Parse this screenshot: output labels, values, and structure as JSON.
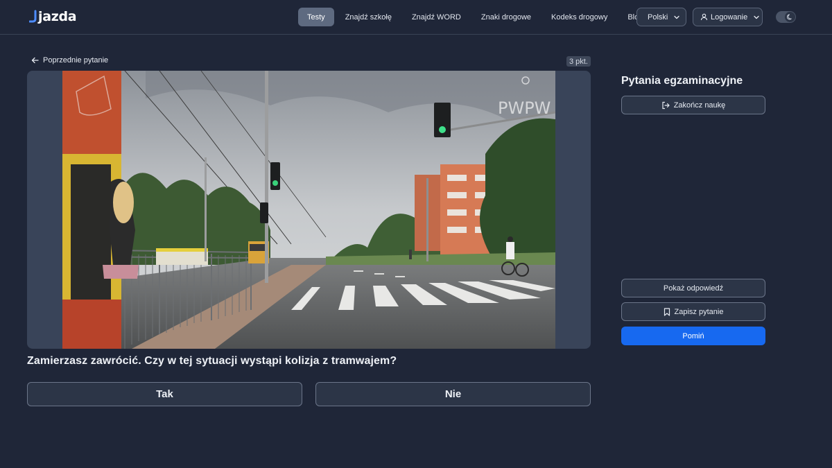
{
  "brand": {
    "name": "jazda",
    "colors": {
      "background": "#1f2638",
      "accent": "#1769f0",
      "nav_active": "#5e6a80"
    }
  },
  "nav": {
    "items": [
      {
        "label": "Testy",
        "active": true
      },
      {
        "label": "Znajdź szkołę",
        "active": false
      },
      {
        "label": "Znajdź WORD",
        "active": false
      },
      {
        "label": "Znaki drogowe",
        "active": false
      },
      {
        "label": "Kodeks drogowy",
        "active": false
      },
      {
        "label": "Blog",
        "active": false
      }
    ],
    "language": {
      "label": "Polski",
      "icon": "chevron-down-icon"
    },
    "login": {
      "label": "Logowanie",
      "icon": "user-icon"
    },
    "theme_toggle": {
      "icon": "moon-icon",
      "state": "dark"
    }
  },
  "question_view": {
    "back_label": "Poprzednie pytanie",
    "points": "3 pkt.",
    "media_watermark": "PWPW",
    "question": "Zamierzasz zawrócić. Czy w tej sytuacji wystąpi kolizja z tramwajem?",
    "answers": [
      "Tak",
      "Nie"
    ]
  },
  "side_panel": {
    "title": "Pytania egzaminacyjne",
    "finish_label": "Zakończ naukę",
    "show_answer_label": "Pokaż odpowiedź",
    "save_label": "Zapisz pytanie",
    "skip_label": "Pomiń"
  }
}
